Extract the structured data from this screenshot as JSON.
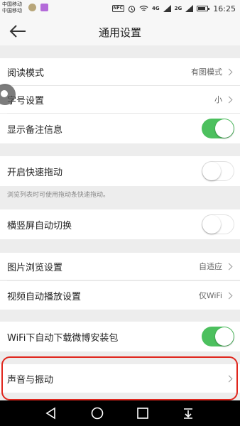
{
  "status_bar": {
    "carrier_1": "中国移动",
    "carrier_2": "中国移动",
    "nfc": "NFC",
    "net_1": "4G",
    "net_2": "2G",
    "time": "16:25",
    "battery_level": 0.85
  },
  "header": {
    "title": "通用设置"
  },
  "settings": {
    "reading_mode": {
      "label": "阅读模式",
      "value": "有图模式"
    },
    "font_size": {
      "label": "字号设置",
      "value": "小"
    },
    "show_remarks": {
      "label": "显示备注信息",
      "on": true
    },
    "quick_drag": {
      "label": "开启快速拖动",
      "on": false,
      "hint": "浏览列表时可使用拖动条快速拖动。"
    },
    "auto_rotate": {
      "label": "横竖屏自动切换",
      "on": false
    },
    "image_browse": {
      "label": "图片浏览设置",
      "value": "自适应"
    },
    "video_autoplay": {
      "label": "视频自动播放设置",
      "value": "仅WiFi"
    },
    "wifi_download": {
      "label": "WiFi下自动下载微博安装包",
      "on": true
    },
    "sound_vibration": {
      "label": "声音与振动"
    }
  },
  "colors": {
    "toggle_on": "#4cc05e",
    "highlight": "#e0261d"
  }
}
